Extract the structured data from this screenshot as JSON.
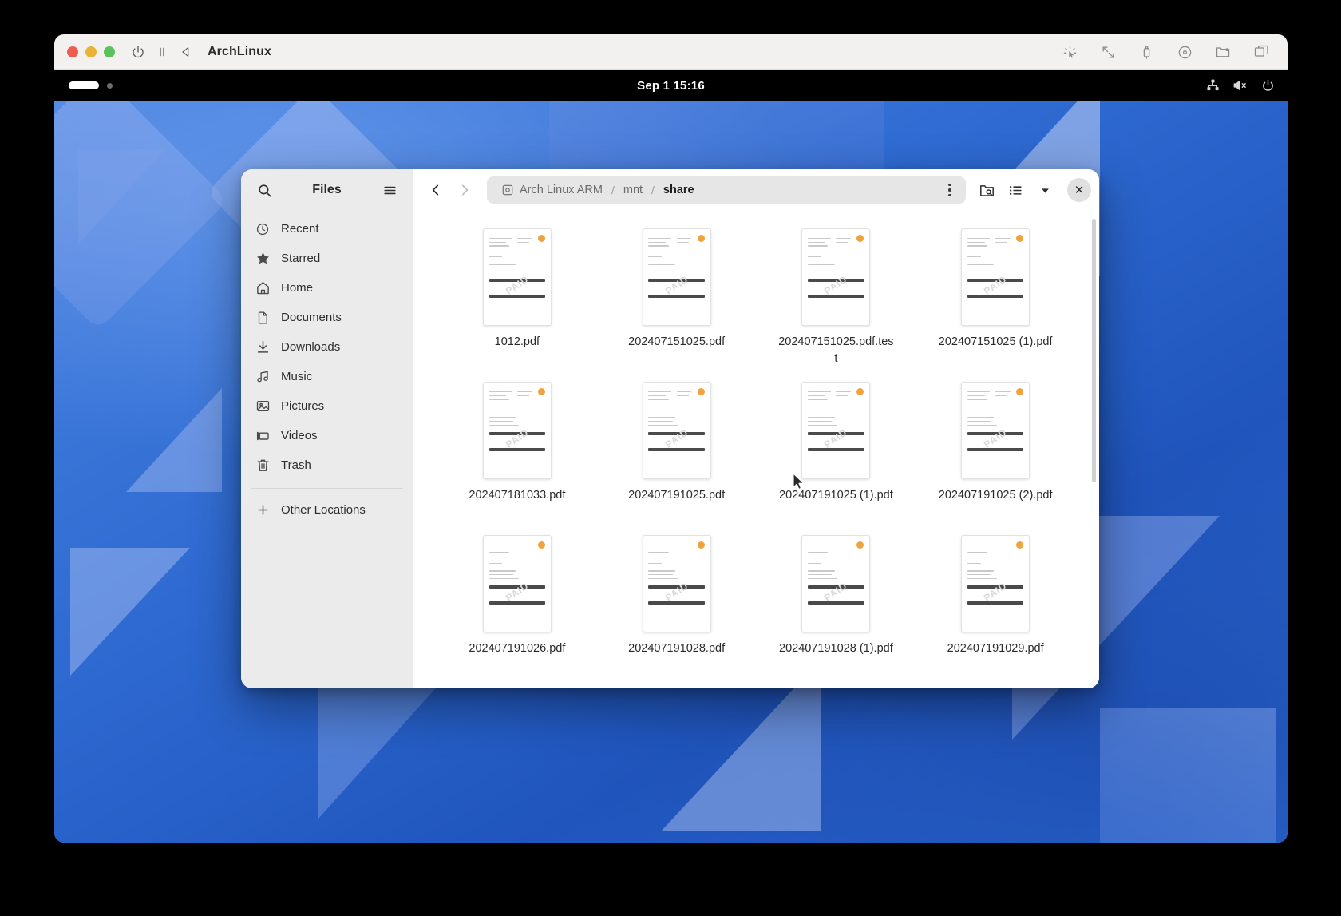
{
  "vm": {
    "title": "ArchLinux",
    "traffic_lights": [
      "close",
      "minimize",
      "zoom"
    ],
    "toolbar_left_icons": [
      "power-icon",
      "pause-icon",
      "play-back-icon"
    ],
    "toolbar_right_icons": [
      "brightness-icon",
      "fullscreen-icon",
      "usb-icon",
      "disc-icon",
      "folder-share-icon",
      "windows-icon"
    ],
    "colors": {
      "red": "#f05b53",
      "yellow": "#e9b336",
      "green": "#5bc15b",
      "titlebar_bg": "#f2f1f0"
    }
  },
  "guest_topbar": {
    "clock": "Sep 1 15:16",
    "tray_icons": [
      "accessibility-icon",
      "volume-muted-icon",
      "power-icon"
    ]
  },
  "files_window": {
    "sidebar": {
      "search_icon": "search-icon",
      "title": "Files",
      "menu_icon": "hamburger-menu-icon",
      "items": [
        {
          "label": "Recent",
          "icon": "clock-icon"
        },
        {
          "label": "Starred",
          "icon": "star-icon"
        },
        {
          "label": "Home",
          "icon": "home-icon"
        },
        {
          "label": "Documents",
          "icon": "document-icon"
        },
        {
          "label": "Downloads",
          "icon": "download-icon"
        },
        {
          "label": "Music",
          "icon": "music-note-icon"
        },
        {
          "label": "Pictures",
          "icon": "image-icon"
        },
        {
          "label": "Videos",
          "icon": "video-camera-icon"
        },
        {
          "label": "Trash",
          "icon": "trash-icon"
        }
      ],
      "other_locations": {
        "label": "Other Locations",
        "icon": "plus-icon"
      }
    },
    "header": {
      "back_label": "Back",
      "forward_label": "Forward",
      "breadcrumb": [
        {
          "label": "Arch Linux ARM",
          "icon": "drive-icon",
          "current": false
        },
        {
          "label": "mnt",
          "current": false
        },
        {
          "label": "share",
          "current": true
        }
      ],
      "separator": "/",
      "path_menu_icon": "vertical-dots-icon",
      "search_folder_icon": "search-folder-icon",
      "view_list_icon": "list-view-icon",
      "view_dropdown_icon": "chevron-down-icon",
      "close_label": "✕"
    },
    "files": [
      {
        "name": "1012.pdf",
        "type": "pdf"
      },
      {
        "name": "202407151025.pdf",
        "type": "pdf"
      },
      {
        "name": "202407151025.pdf.test",
        "type": "pdf"
      },
      {
        "name": "202407151025 (1).pdf",
        "type": "pdf"
      },
      {
        "name": "202407181033.pdf",
        "type": "pdf"
      },
      {
        "name": "202407191025.pdf",
        "type": "pdf"
      },
      {
        "name": "202407191025 (1).pdf",
        "type": "pdf"
      },
      {
        "name": "202407191025 (2).pdf",
        "type": "pdf"
      },
      {
        "name": "202407191026.pdf",
        "type": "pdf"
      },
      {
        "name": "202407191028.pdf",
        "type": "pdf"
      },
      {
        "name": "202407191028 (1).pdf",
        "type": "pdf"
      },
      {
        "name": "202407191029.pdf",
        "type": "pdf"
      }
    ]
  }
}
